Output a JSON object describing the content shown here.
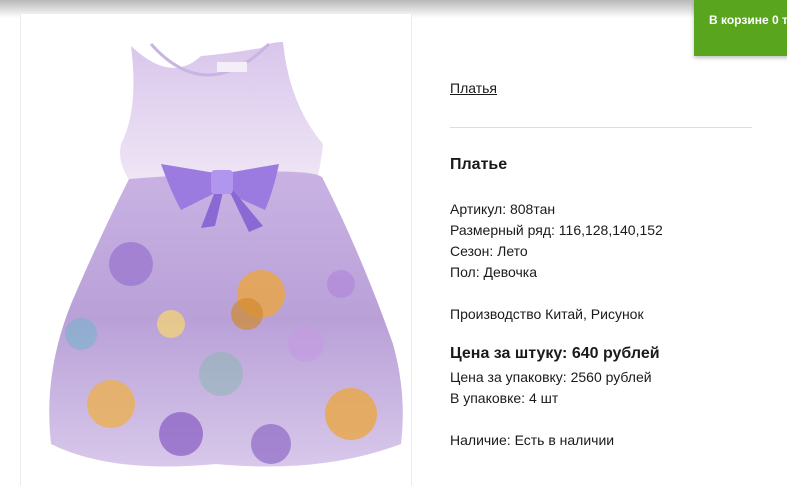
{
  "cart": {
    "label": "В корзине 0 т"
  },
  "breadcrumb": {
    "label": "Платья"
  },
  "product": {
    "title": "Платье",
    "article": "Артикул: 808тан",
    "sizes": "Размерный ряд: 116,128,140,152",
    "season": "Сезон: Лето",
    "gender": "Пол: Девочка",
    "production": "Производство Китай, Рисунок",
    "price_unit": "Цена за штуку: 640 рублей",
    "price_pack": "Цена за упаковку: 2560 рублей",
    "pack_qty": "В упаковке: 4 шт",
    "availability": "Наличие: Есть в наличии"
  },
  "colors": {
    "accent": "#5aa51e",
    "dress_lilac": "#b89ad6",
    "bow": "#9b7be0"
  }
}
